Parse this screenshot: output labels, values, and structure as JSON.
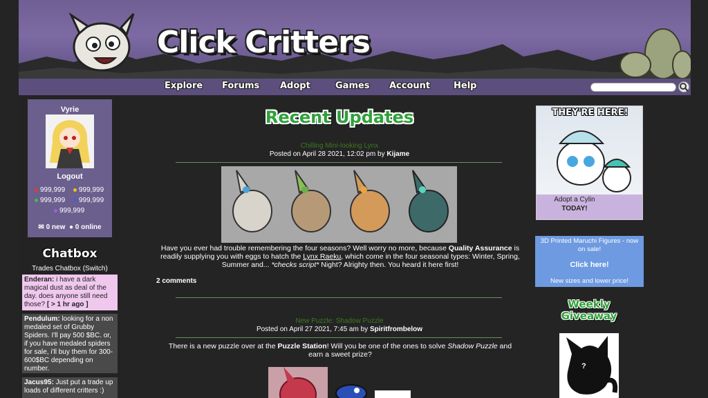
{
  "header": {
    "logo_text": "Click Critters"
  },
  "nav": {
    "items": [
      "Explore",
      "Forums",
      "Adopt",
      "Games",
      "Account",
      "Help"
    ],
    "search_placeholder": ""
  },
  "user": {
    "name": "Vyrie",
    "logout_label": "Logout",
    "currencies": [
      {
        "color": "#e03a3a",
        "amount": "999,999"
      },
      {
        "color": "#e8c51a",
        "amount": "999,999"
      },
      {
        "color": "#35c24a",
        "amount": "999,999"
      },
      {
        "color": "#3a63e0",
        "amount": "999,999"
      },
      {
        "color": "#a95ad8",
        "amount": "999,999"
      }
    ],
    "new_messages": "0 new",
    "online": "0 online"
  },
  "chatbox": {
    "title": "Chatbox",
    "subtitle": "Trades Chatbox (Switch)",
    "messages": [
      {
        "user": "Enderan:",
        "text": "i have a dark magical dust as deal of the day. does anyone still need those?",
        "time": "[ > 1 hr ago ]"
      },
      {
        "user": "Pendulum:",
        "text": "looking for a non medaled set of Grubby Spiders. I'll pay 500 $BC. or, if you have medaled spiders for sale, i'll buy them for 300-600$BC depending on number."
      },
      {
        "user": "Jacus95:",
        "text": "Just put a trade up loads of different critters :)"
      }
    ]
  },
  "main": {
    "title": "Recent Updates",
    "posts": [
      {
        "title": "Chilling Mini-looking Lynx",
        "meta_prefix": "Posted on April 28 2021, 12:02 pm by ",
        "author": "Kijame",
        "body_1": "Have you ever had trouble remembering the four seasons? Well worry no more, because ",
        "body_bold_1": "Quality Assurance",
        "body_2": " is readily supplying you with eggs to hatch the ",
        "body_link": "Lynx Raeku",
        "body_3": ", which come in the four seasonal types: Winter, Spring, Summer and... ",
        "body_italic": "*checks script*",
        "body_4": " Night? Alrighty then. You heard it here first!",
        "comments": "2 comments"
      },
      {
        "title": "New Puzzle: Shadow Puzzle",
        "meta_prefix": "Posted on April 27 2021, 7:45 am by ",
        "author": "Spiritfrombelow",
        "body_1": "There is a new puzzle over at the ",
        "body_bold_1": "Puzzle Station",
        "body_2": "! Will you be one of the ones to solve ",
        "body_italic": "Shadow Puzzle",
        "body_3": " and earn a sweet prize?"
      }
    ]
  },
  "right": {
    "ad1_header": "THEY'RE HERE!",
    "ad1_caption_1": "Adopt a Cylin",
    "ad1_caption_2": "TODAY!",
    "ad2_line1": "3D Printed Maruchi Figures - now on sale!",
    "ad2_cta": "Click here!",
    "ad2_line2": "New sizes and lower price!",
    "weekly_1": "Weekly",
    "weekly_2": "Giveaway",
    "giveaway_mark": "?"
  }
}
